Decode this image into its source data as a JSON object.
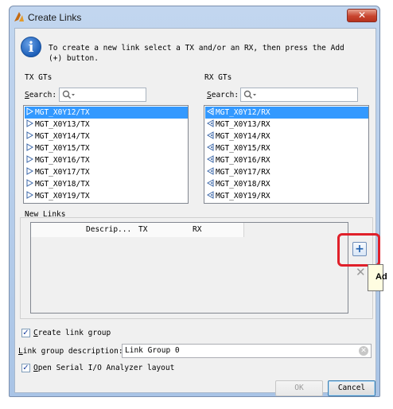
{
  "window": {
    "title": "Create Links",
    "close_label": "✕"
  },
  "info": {
    "text": "To create a new link select a TX and/or an RX, then press the Add (+) button."
  },
  "tx": {
    "group_title": "TX GTs",
    "search_label_underlined": "S",
    "search_label_rest": "earch:",
    "search_value": "",
    "items": [
      "MGT_X0Y12/TX",
      "MGT_X0Y13/TX",
      "MGT_X0Y14/TX",
      "MGT_X0Y15/TX",
      "MGT_X0Y16/TX",
      "MGT_X0Y17/TX",
      "MGT_X0Y18/TX",
      "MGT_X0Y19/TX"
    ],
    "selected_index": 0
  },
  "rx": {
    "group_title": "RX GTs",
    "search_label_underlined": "S",
    "search_label_rest": "earch:",
    "search_value": "",
    "items": [
      "MGT_X0Y12/RX",
      "MGT_X0Y13/RX",
      "MGT_X0Y14/RX",
      "MGT_X0Y15/RX",
      "MGT_X0Y16/RX",
      "MGT_X0Y17/RX",
      "MGT_X0Y18/RX",
      "MGT_X0Y19/RX"
    ],
    "selected_index": 0
  },
  "new_links": {
    "group_title": "New Links",
    "columns": [
      "",
      "Descrip...",
      "TX",
      "RX"
    ],
    "rows": []
  },
  "actions": {
    "add_label": "+",
    "tooltip_text": "Ad",
    "remove_label": "✕"
  },
  "create_link_group": {
    "checked": true,
    "label_underlined": "C",
    "label_rest": "reate link group"
  },
  "link_group_description": {
    "label_underlined": "L",
    "label_rest": "ink group description:",
    "value": "Link Group 0"
  },
  "open_analyzer": {
    "checked": true,
    "label_underlined": "O",
    "label_rest": "pen Serial I/O Analyzer layout"
  },
  "buttons": {
    "ok_label": "OK",
    "cancel_label": "Cancel"
  },
  "colors": {
    "selection": "#3399ff",
    "highlight": "#e0202a",
    "title_bar": "#b9cfeb"
  },
  "icons": {
    "app": "vivado-logo-icon",
    "info": "info-icon",
    "search": "search-icon",
    "tx_item": "tx-gt-icon",
    "rx_item": "rx-gt-icon",
    "add": "plus-icon",
    "remove": "remove-icon",
    "clear": "clear-field-icon"
  }
}
